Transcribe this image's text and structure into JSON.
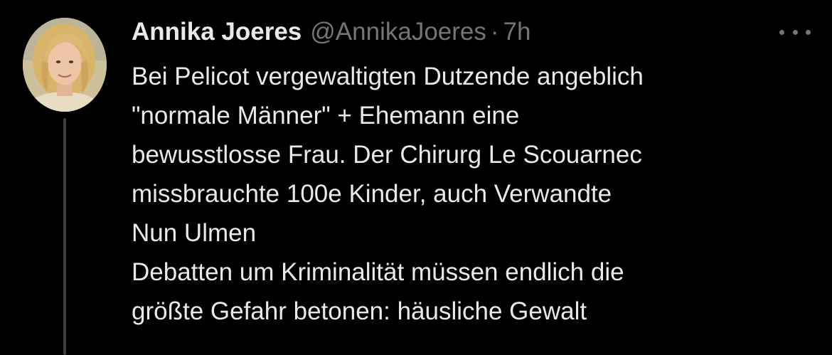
{
  "tweet": {
    "author_name": "Annika Joeres",
    "handle": "@AnnikaJoeres",
    "separator": "·",
    "time": "7h",
    "more_icon": "more-horizontal-icon",
    "avatar": "profile-photo",
    "lines": [
      "Bei Pelicot vergewaltigten Dutzende angeblich",
      "\"normale Männer\" + Ehemann eine",
      "bewusstlosse Frau. Der Chirurg Le Scouarnec",
      "missbrauchte 100e Kinder, auch Verwandte",
      "Nun Ulmen",
      "Debatten um Kriminalität müssen endlich die",
      "größte Gefahr betonen: häusliche Gewalt"
    ]
  },
  "colors": {
    "background": "#000000",
    "text_primary": "#e7e9ea",
    "text_secondary": "#71767b",
    "thread_line": "#3a3d41"
  }
}
